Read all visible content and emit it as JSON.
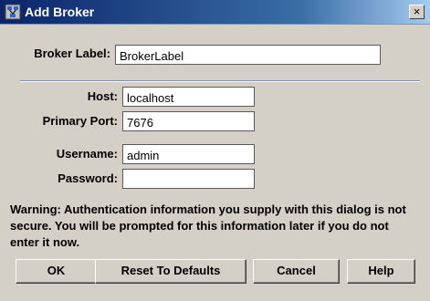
{
  "window": {
    "title": "Add Broker",
    "close_glyph": "×"
  },
  "form": {
    "broker_label": {
      "label": "Broker Label:",
      "value": "BrokerLabel"
    },
    "host": {
      "label": "Host:",
      "value": "localhost"
    },
    "primary_port": {
      "label": "Primary Port:",
      "value": "7676"
    },
    "username": {
      "label": "Username:",
      "value": "admin"
    },
    "password": {
      "label": "Password:",
      "value": ""
    }
  },
  "warning": "Warning: Authentication information you supply with this dialog is not secure. You will be prompted for this information later if you do not enter it now.",
  "buttons": {
    "ok": "OK",
    "reset": "Reset To Defaults",
    "cancel": "Cancel",
    "help": "Help"
  },
  "colors": {
    "titlebar_start": "#0a246a",
    "titlebar_end": "#a6caf0",
    "dialog_background": "#d4d0c8"
  },
  "icons": {
    "app": "broker-app-icon",
    "close": "close-icon"
  }
}
